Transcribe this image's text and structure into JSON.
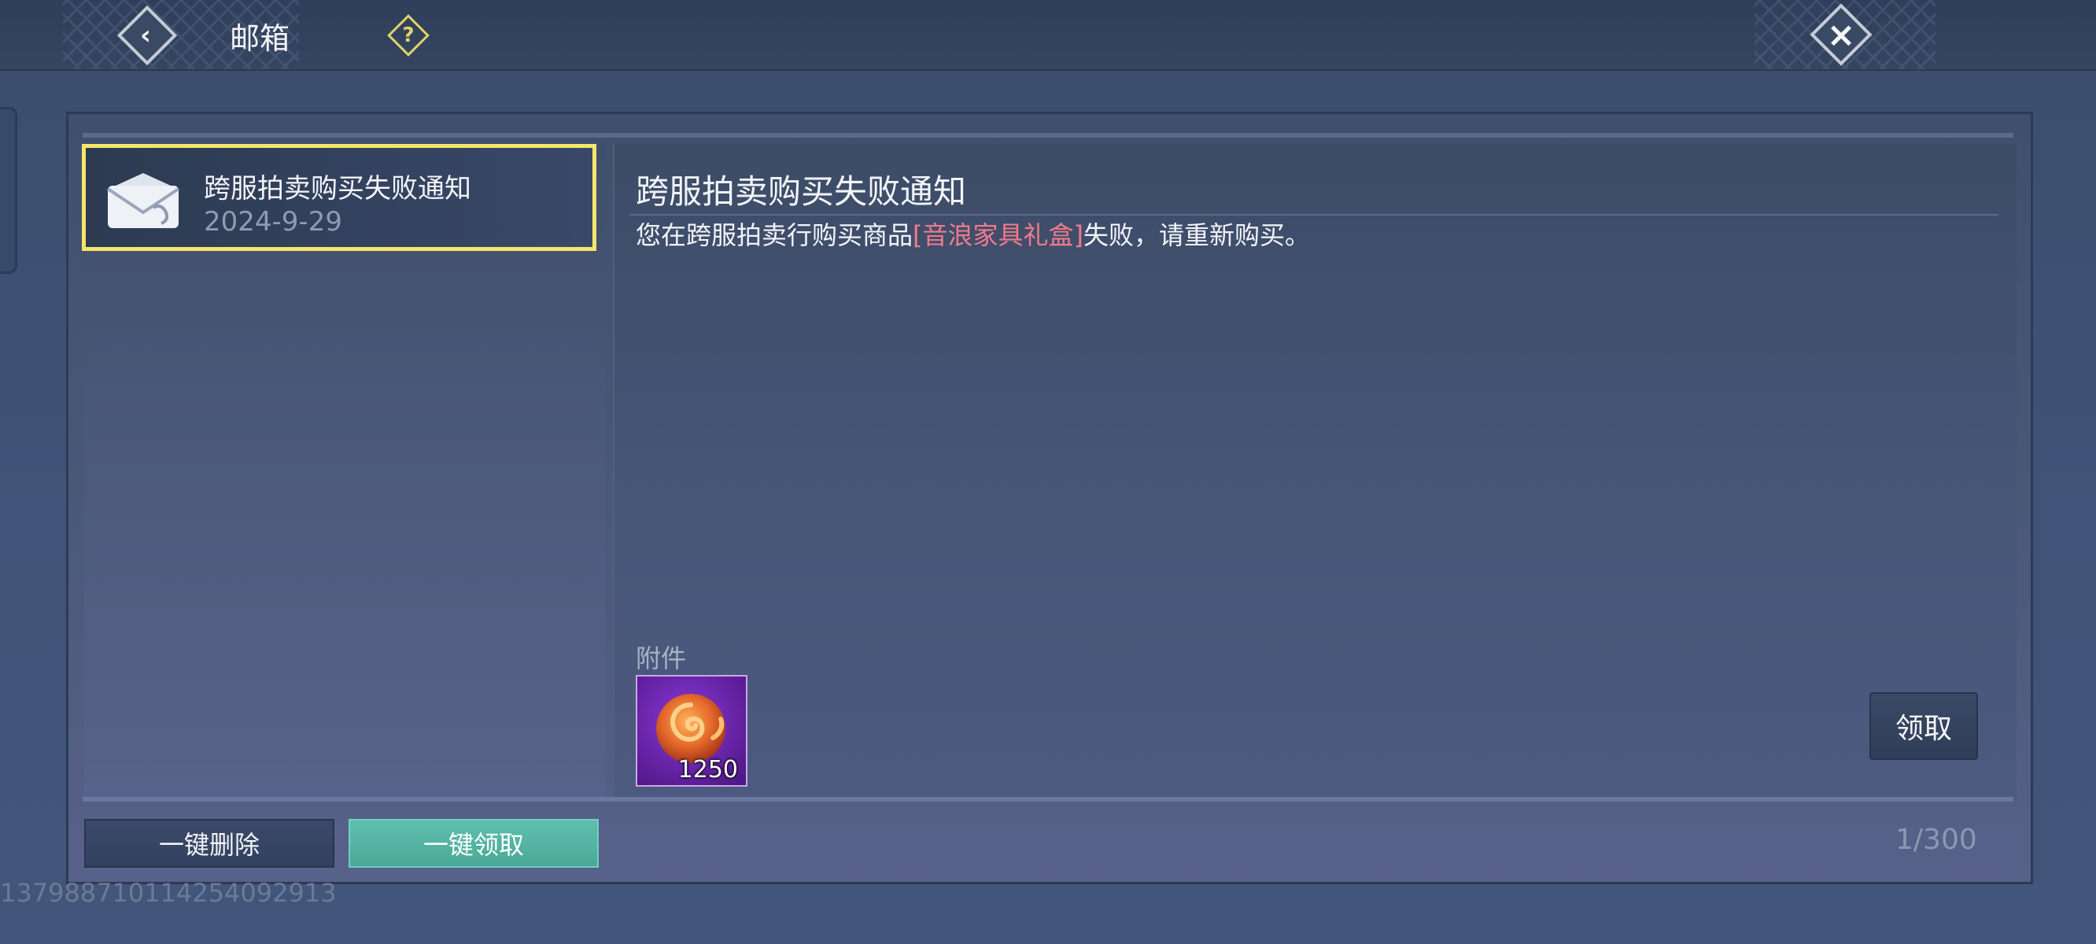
{
  "header": {
    "title": "邮箱",
    "back_icon": "back-arrow-icon",
    "help_icon": "help-icon",
    "close_icon": "close-icon"
  },
  "mail_list": {
    "items": [
      {
        "title": "跨服拍卖购买失败通知",
        "date": "2024-9-29",
        "icon": "envelope-icon",
        "selected": true
      }
    ]
  },
  "detail": {
    "title": "跨服拍卖购买失败通知",
    "body_prefix": "您在跨服拍卖行购买商品",
    "body_highlight": "[音浪家具礼盒]",
    "body_suffix": "失败，请重新购买。",
    "highlight_color": "#f27a8a",
    "attachment_label": "附件",
    "attachments": [
      {
        "icon": "coin-icon",
        "count": "1250"
      }
    ],
    "claim_label": "领取"
  },
  "footer": {
    "delete_all_label": "一键删除",
    "claim_all_label": "一键领取",
    "counter": "1/300",
    "claim_all_color": "#5fbfae"
  },
  "uid": "1379887101142540929​13"
}
